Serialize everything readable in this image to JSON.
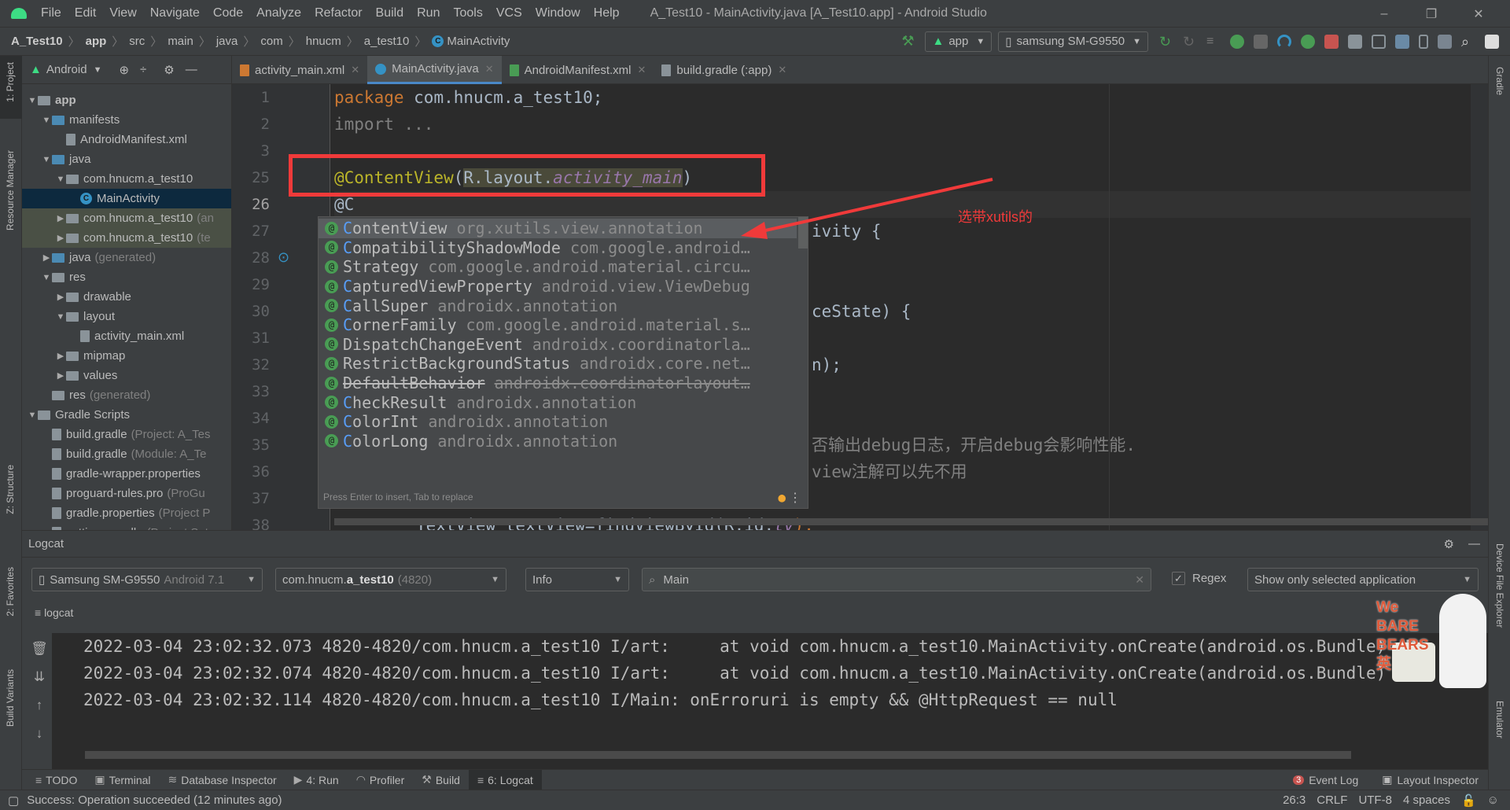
{
  "menubar": {
    "items": [
      "File",
      "Edit",
      "View",
      "Navigate",
      "Code",
      "Analyze",
      "Refactor",
      "Build",
      "Run",
      "Tools",
      "VCS",
      "Window",
      "Help"
    ],
    "window_title": "A_Test10 - MainActivity.java [A_Test10.app] - Android Studio"
  },
  "window_controls": {
    "minimize": "–",
    "restore": "❐",
    "close": "✕"
  },
  "breadcrumb": [
    "A_Test10",
    "app",
    "src",
    "main",
    "java",
    "com",
    "hnucm",
    "a_test10",
    "MainActivity"
  ],
  "toolbar": {
    "run_config": "app",
    "device": "samsung SM-G9550",
    "accent_colors": {
      "android": "#3ddc84",
      "stop": "#c75450",
      "debug": "#499c54"
    }
  },
  "project_panel": {
    "view": "Android",
    "tree": [
      {
        "label": "app",
        "depth": 0,
        "expanded": true,
        "bold": true
      },
      {
        "label": "manifests",
        "depth": 1,
        "expanded": true
      },
      {
        "label": "AndroidManifest.xml",
        "depth": 2
      },
      {
        "label": "java",
        "depth": 1,
        "expanded": true
      },
      {
        "label": "com.hnucm.a_test10",
        "depth": 2,
        "expanded": true
      },
      {
        "label": "MainActivity",
        "depth": 3,
        "selected": true
      },
      {
        "label": "com.hnucm.a_test10",
        "hint": "(an",
        "depth": 2,
        "expanded": false
      },
      {
        "label": "com.hnucm.a_test10",
        "hint": "(te",
        "depth": 2,
        "expanded": false
      },
      {
        "label": "java",
        "hint": "(generated)",
        "depth": 1,
        "expanded": false
      },
      {
        "label": "res",
        "depth": 1,
        "expanded": true
      },
      {
        "label": "drawable",
        "depth": 2,
        "expanded": false
      },
      {
        "label": "layout",
        "depth": 2,
        "expanded": true
      },
      {
        "label": "activity_main.xml",
        "depth": 3
      },
      {
        "label": "mipmap",
        "depth": 2,
        "expanded": false
      },
      {
        "label": "values",
        "depth": 2,
        "expanded": false
      },
      {
        "label": "res",
        "hint": "(generated)",
        "depth": 1
      },
      {
        "label": "Gradle Scripts",
        "depth": 0,
        "expanded": true
      },
      {
        "label": "build.gradle",
        "hint": "(Project: A_Tes",
        "depth": 1
      },
      {
        "label": "build.gradle",
        "hint": "(Module: A_Te",
        "depth": 1
      },
      {
        "label": "gradle-wrapper.properties",
        "depth": 1
      },
      {
        "label": "proguard-rules.pro",
        "hint": "(ProGu",
        "depth": 1
      },
      {
        "label": "gradle.properties",
        "hint": "(Project P",
        "depth": 1
      },
      {
        "label": "settings.gradle",
        "hint": "(Project Set",
        "depth": 1
      }
    ]
  },
  "side_tools": {
    "left": [
      "1: Project",
      "Resource Manager",
      "Z: Structure",
      "2: Favorites",
      "Build Variants"
    ],
    "right": [
      "Gradle",
      "Device File Explorer",
      "Emulator"
    ]
  },
  "editor_tabs": [
    {
      "label": "activity_main.xml"
    },
    {
      "label": "MainActivity.java",
      "active": true
    },
    {
      "label": "AndroidManifest.xml"
    },
    {
      "label": "build.gradle (:app)"
    }
  ],
  "editor": {
    "line_numbers": [
      "1",
      "2",
      "3",
      "25",
      "26",
      "27",
      "28",
      "29",
      "30",
      "31",
      "32",
      "33",
      "34",
      "35",
      "36",
      "37",
      "38"
    ],
    "current_line": "26",
    "line1": {
      "kw": "package",
      "rest": " com.hnucm.a_test10;"
    },
    "line3": "import ...",
    "line25": {
      "ann": "@ContentView",
      "p1": "(",
      "ref": "R.layout.",
      "field": "activity_main",
      "p2": ")"
    },
    "line26": "@C",
    "frag27": "ivity {",
    "frag30": "ceState) {",
    "frag32": "n);",
    "frag35": "否输出debug日志，开启debug会影响性能.",
    "frag36": "view注解可以先不用",
    "line38": {
      "a": "TextView textView=findViewById(R.id.",
      "field": "tv",
      "b": ");"
    }
  },
  "completion": {
    "items": [
      {
        "pre": "C",
        "name": "ontentView",
        "pkg": "org.xutils.view.annotation",
        "selected": true
      },
      {
        "pre": "C",
        "name": "ompatibilityShadowMode",
        "pkg": "com.google.android…"
      },
      {
        "pre": "",
        "name": "Strategy",
        "pkg": "com.google.android.material.circu…"
      },
      {
        "pre": "C",
        "name": "apturedViewProperty",
        "pkg": "android.view.ViewDebug"
      },
      {
        "pre": "C",
        "name": "allSuper",
        "pkg": "androidx.annotation"
      },
      {
        "pre": "C",
        "name": "ornerFamily",
        "pkg": "com.google.android.material.s…"
      },
      {
        "pre": "",
        "name": "DispatchChangeEvent",
        "pkg": "androidx.coordinatorla…"
      },
      {
        "pre": "",
        "name": "RestrictBackgroundStatus",
        "pkg": "androidx.core.net…"
      },
      {
        "pre": "",
        "name": "DefaultBehavior",
        "pkg": "androidx.coordinatorlayout…",
        "deprecated": true
      },
      {
        "pre": "C",
        "name": "heckResult",
        "pkg": "androidx.annotation"
      },
      {
        "pre": "C",
        "name": "olorInt",
        "pkg": "androidx.annotation"
      },
      {
        "pre": "C",
        "name": "olorLong",
        "pkg": "androidx.annotation"
      }
    ],
    "footer": "Press Enter to insert, Tab to replace"
  },
  "annotation": {
    "text": "选带xutils的",
    "color": "#f03a3a"
  },
  "logcat": {
    "title": "logcat_header",
    "header": "Logcat",
    "device": "Samsung SM-G9550",
    "device_os": "Android 7.1",
    "process_pre": "com.hnucm.",
    "process_bold": "a_test10",
    "process_pid": "(4820)",
    "level": "Info",
    "search": "Main",
    "regex_label": "Regex",
    "regex_checked": true,
    "filter": "Show only selected application",
    "sub_tab": "logcat",
    "lines": [
      "2022-03-04 23:02:32.073 4820-4820/com.hnucm.a_test10 I/art:     at void com.hnucm.a_test10.MainActivity.onCreate(android.os.Bundle) (Ma",
      "2022-03-04 23:02:32.074 4820-4820/com.hnucm.a_test10 I/art:     at void com.hnucm.a_test10.MainActivity.onCreate(android.os.Bundle)",
      "2022-03-04 23:02:32.114 4820-4820/com.hnucm.a_test10 I/Main: onErroruri is empty && @HttpRequest == null"
    ]
  },
  "bottom_tabs": [
    {
      "label": "TODO"
    },
    {
      "label": "Terminal"
    },
    {
      "label": "Database Inspector"
    },
    {
      "label": "4: Run"
    },
    {
      "label": "Profiler"
    },
    {
      "label": "Build"
    },
    {
      "label": "6: Logcat",
      "active": true
    }
  ],
  "bottom_right": {
    "event_log": "Event Log",
    "event_count": "3",
    "layout_inspector": "Layout Inspector"
  },
  "status": {
    "message": "Success: Operation succeeded (12 minutes ago)",
    "position": "26:3",
    "line_sep": "CRLF",
    "encoding": "UTF-8",
    "indent": "4 spaces"
  },
  "sticker": {
    "text": "We BARE BEARS 英"
  }
}
